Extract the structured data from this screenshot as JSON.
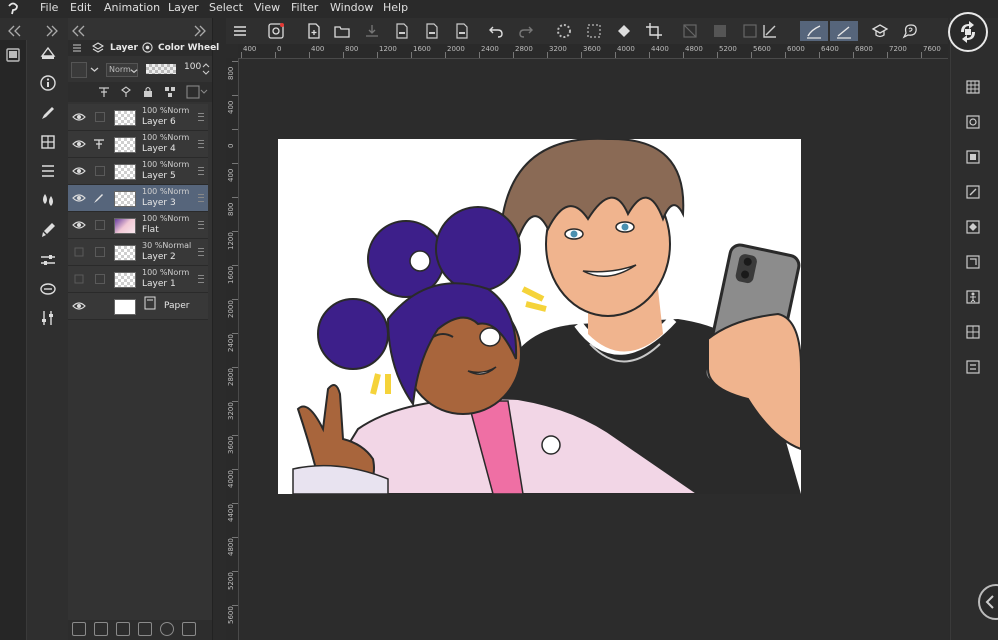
{
  "menubar": {
    "items": [
      "File",
      "Edit",
      "Animation",
      "Layer",
      "Select",
      "View",
      "Filter",
      "Window",
      "Help"
    ]
  },
  "panel": {
    "tab_layer": "Layer",
    "tab_color_wheel": "Color Wheel",
    "blend_mode": "Norm",
    "opacity": "100",
    "layers": [
      {
        "name": "Layer 6",
        "opacity": "100 %Norm",
        "visible": true,
        "selected": false,
        "thumb": "transparent"
      },
      {
        "name": "Layer 4",
        "opacity": "100 %Norm",
        "visible": true,
        "selected": false,
        "thumb": "transparent"
      },
      {
        "name": "Layer 5",
        "opacity": "100 %Norm",
        "visible": true,
        "selected": false,
        "thumb": "transparent"
      },
      {
        "name": "Layer 3",
        "opacity": "100 %Norm",
        "visible": true,
        "selected": true,
        "thumb": "transparent"
      },
      {
        "name": "Flat",
        "opacity": "100 %Norm",
        "visible": true,
        "selected": false,
        "thumb": "flat"
      },
      {
        "name": "Layer 2",
        "opacity": "30 %Normal",
        "visible": false,
        "selected": false,
        "thumb": "transparent"
      },
      {
        "name": "Layer 1",
        "opacity": "100 %Norm",
        "visible": false,
        "selected": false,
        "thumb": "transparent"
      },
      {
        "name": "Paper",
        "opacity": "",
        "visible": true,
        "selected": false,
        "thumb": "white"
      }
    ]
  },
  "ruler": {
    "top_labels": [
      "400",
      "0",
      "400",
      "800",
      "1200",
      "1600",
      "2000",
      "2400",
      "2800",
      "3200",
      "3600",
      "4000",
      "4400",
      "4800",
      "5200",
      "5600",
      "6000",
      "6400",
      "6800",
      "7200",
      "7600"
    ],
    "left_labels": [
      "800",
      "400",
      "0",
      "400",
      "800",
      "1200",
      "1600",
      "2000",
      "2400",
      "2800",
      "3200",
      "3600",
      "4000",
      "4400",
      "4800",
      "5200",
      "5600"
    ]
  },
  "colors": {
    "accent": "#56657b",
    "hair_purple": "#3d1f8a",
    "skin_dark": "#a8653c",
    "skin_light": "#f0b48e",
    "hair_brown": "#8a6a55",
    "kimono_pink": "#f2d6e6",
    "collar_pink": "#ef6fa4",
    "shirt": "#2a2a2a",
    "phone": "#8c8c8c",
    "ribbon": "#f5d33a"
  }
}
